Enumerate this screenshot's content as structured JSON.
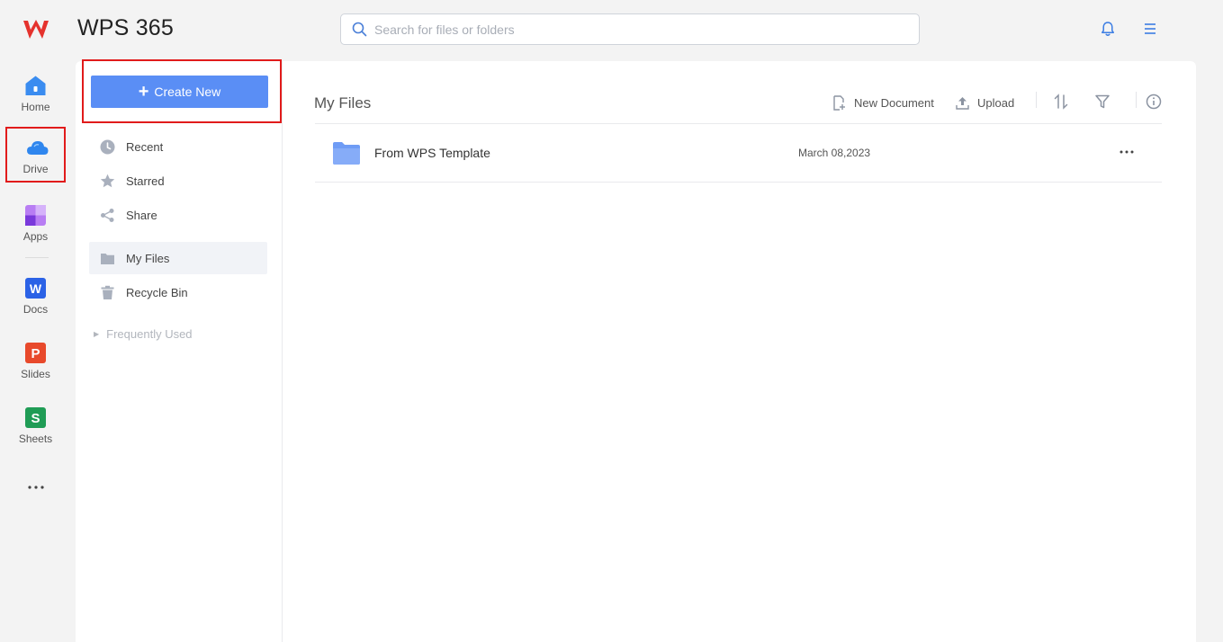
{
  "app": {
    "title": "WPS 365"
  },
  "search": {
    "placeholder": "Search for files or folders"
  },
  "rail": {
    "items": [
      {
        "label": "Home"
      },
      {
        "label": "Drive"
      },
      {
        "label": "Apps"
      },
      {
        "label": "Docs"
      },
      {
        "label": "Slides"
      },
      {
        "label": "Sheets"
      }
    ]
  },
  "sidenav": {
    "create_label": "Create New",
    "items": [
      {
        "label": "Recent"
      },
      {
        "label": "Starred"
      },
      {
        "label": "Share"
      },
      {
        "label": "My Files"
      },
      {
        "label": "Recycle Bin"
      }
    ],
    "frequently_used": "Frequently Used"
  },
  "content": {
    "title": "My Files",
    "toolbar": {
      "new_document": "New Document",
      "upload": "Upload"
    },
    "files": [
      {
        "name": "From WPS Template",
        "date": "March 08,2023"
      }
    ]
  },
  "colors": {
    "accent": "#5a8ef5",
    "highlight_border": "#e11b1b",
    "folder": "#6f9cf5",
    "logo": "#e5322d"
  },
  "icons": {
    "logo": "wps-logo-icon",
    "search": "search-icon",
    "bell": "bell-icon",
    "menu": "hamburger-menu-icon",
    "folder": "folder-icon"
  }
}
